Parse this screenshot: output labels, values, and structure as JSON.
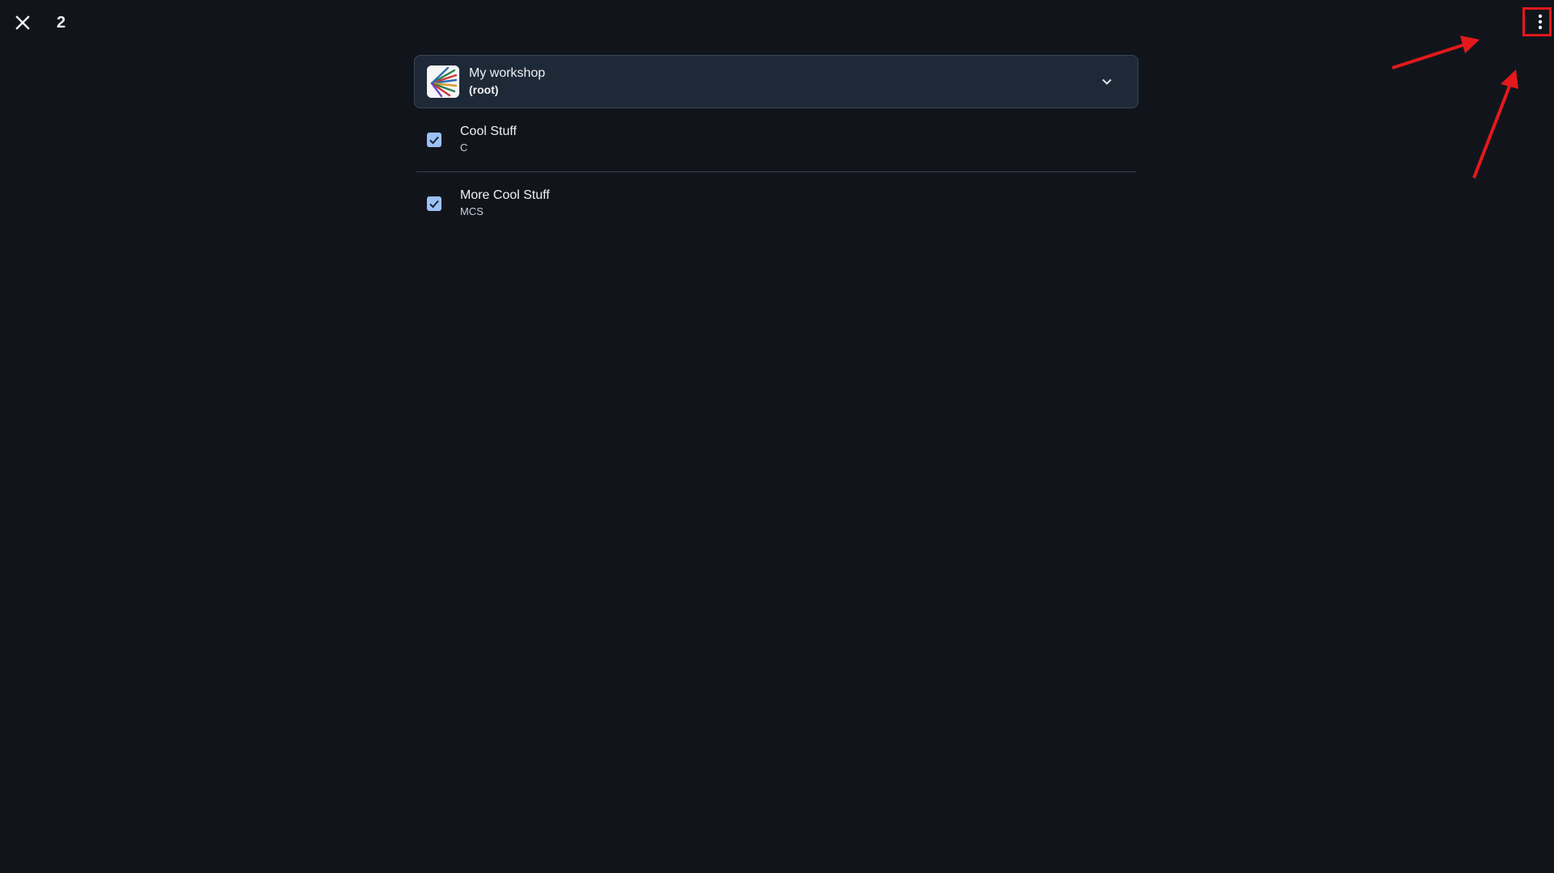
{
  "header": {
    "close_icon": "close-icon",
    "selected_count": "2",
    "more_icon": "more-vertical-icon"
  },
  "workshop_selector": {
    "name": "My workshop",
    "subtitle": "(root)",
    "dropdown_icon": "chevron-down-icon"
  },
  "items": [
    {
      "title": "Cool Stuff",
      "code": "C",
      "checked": true
    },
    {
      "title": "More Cool Stuff",
      "code": "MCS",
      "checked": true
    }
  ],
  "colors": {
    "background": "#11151b",
    "selector_bg": "#1e2938",
    "checkbox": "#9cc1f5",
    "annotation": "#e3191c"
  }
}
